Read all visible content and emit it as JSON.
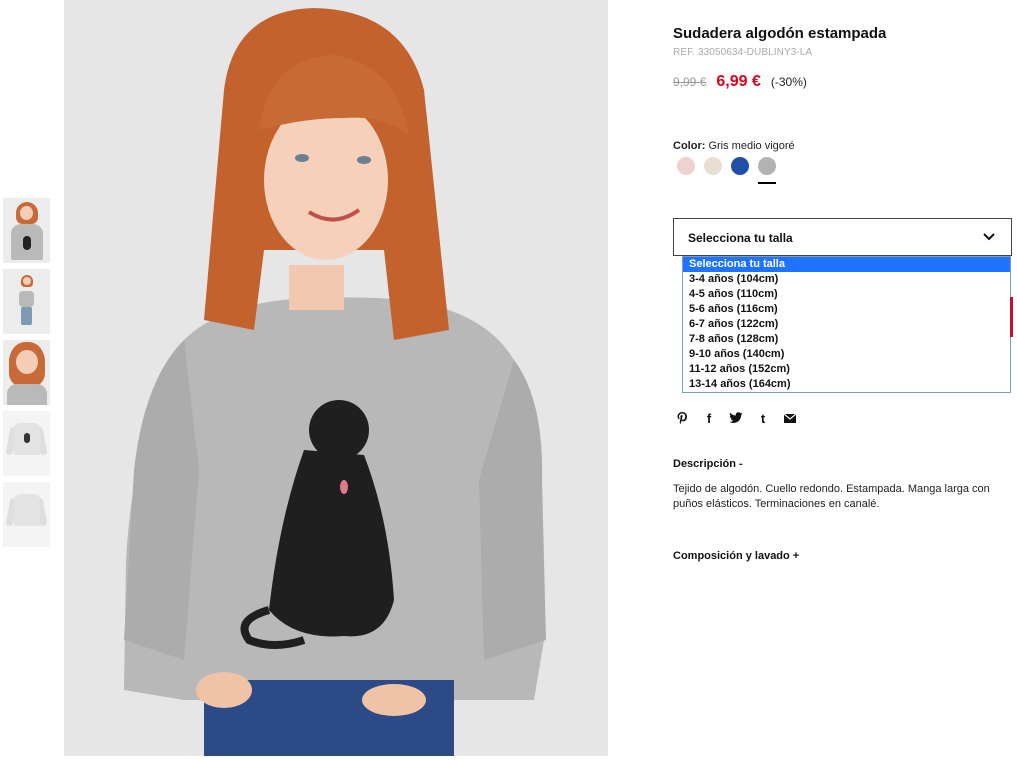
{
  "thumbnails": [
    {
      "alt": "thumbnail-front"
    },
    {
      "alt": "thumbnail-full-body"
    },
    {
      "alt": "thumbnail-close-up"
    },
    {
      "alt": "thumbnail-flat"
    },
    {
      "alt": "thumbnail-flat-back"
    }
  ],
  "product": {
    "title": "Sudadera algodón estampada",
    "ref": "REF. 33050634-DUBLINY3-LA",
    "price_old": "9,99 €",
    "price_new": "6,99 €",
    "discount": "(-30%)"
  },
  "color": {
    "label": "Color:",
    "value": "Gris medio vigoré",
    "swatches": [
      {
        "name": "rosa",
        "hex": "#ecd3d0"
      },
      {
        "name": "beige",
        "hex": "#e9dfd0"
      },
      {
        "name": "azul",
        "hex": "#1f4fa6"
      },
      {
        "name": "gris",
        "hex": "#b3b3b3",
        "selected": true
      }
    ]
  },
  "size_select": {
    "placeholder": "Selecciona tu talla",
    "options": [
      "Selecciona tu talla",
      "3-4 años (104cm)",
      "4-5 años (110cm)",
      "5-6 años (116cm)",
      "6-7 años (122cm)",
      "7-8 años (128cm)",
      "9-10 años (140cm)",
      "11-12 años (152cm)",
      "13-14 años (164cm)"
    ],
    "highlighted_index": 0
  },
  "social": {
    "icons": [
      "pinterest-icon",
      "facebook-icon",
      "twitter-icon",
      "tumblr-icon",
      "email-icon"
    ],
    "glyphs": [
      "℗",
      "f",
      "🐦",
      "t",
      "✉"
    ]
  },
  "description": {
    "heading": "Descripción -",
    "text": "Tejido de algodón. Cuello redondo. Estampada. Manga larga con puños elásticos. Terminaciones en canalé."
  },
  "composition": {
    "heading": "Composición y lavado +"
  },
  "colors": {
    "price_red": "#e0001b",
    "highlight_blue": "#1e74ff",
    "background_gray": "#e8e8e8"
  }
}
